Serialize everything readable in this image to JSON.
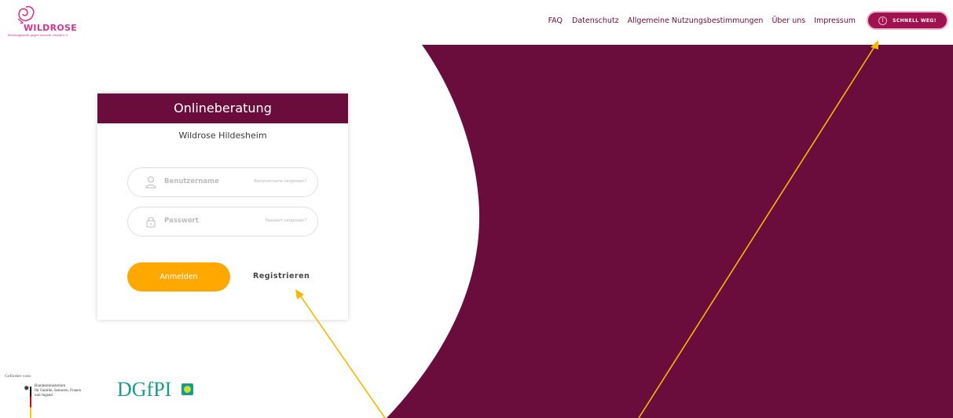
{
  "header": {
    "logo_text": "WILDROSE",
    "logo_subtitle": "Beratungsstelle gegen sexuelle Gewalt e.V.",
    "nav": [
      "FAQ",
      "Datenschutz",
      "Allgemeine Nutzungsbestimmungen",
      "Über uns",
      "Impressum"
    ],
    "quick_exit_label": "SCHNELL WEG!",
    "quick_exit_icon": "!"
  },
  "login": {
    "title": "Onlineberatung",
    "subtitle": "Wildrose Hildesheim",
    "username_placeholder": "Benutzername",
    "username_forgot": "Benutzername vergessen?",
    "password_placeholder": "Passwort",
    "password_forgot": "Passwort vergessen?",
    "login_button": "Anmelden",
    "register_link": "Registrieren"
  },
  "footer": {
    "funded_by": "Gefördert vom:",
    "ministry": "Bundesministerium\nfür Familie, Senioren, Frauen\nund Jugend",
    "partner_logo": "DGfPI"
  },
  "colors": {
    "brand": "#6a0d3c",
    "accent": "#ffa800",
    "logo_pink": "#d6358d",
    "arrow": "#f5b800"
  }
}
